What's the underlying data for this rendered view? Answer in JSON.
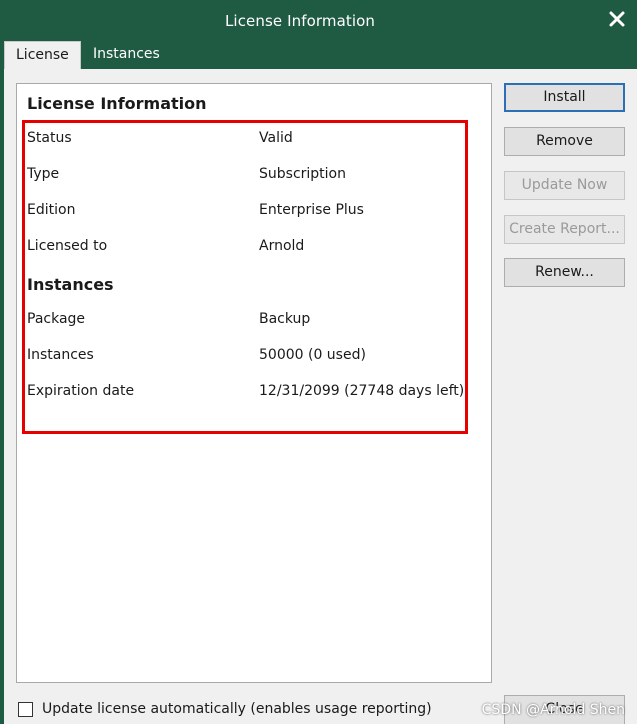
{
  "window": {
    "title": "License Information",
    "close_icon": "close-icon"
  },
  "tabs": [
    {
      "label": "License",
      "active": true
    },
    {
      "label": "Instances",
      "active": false
    }
  ],
  "panel": {
    "license_heading": "License Information",
    "rows": [
      {
        "label": "Status",
        "value": "Valid"
      },
      {
        "label": "Type",
        "value": "Subscription"
      },
      {
        "label": "Edition",
        "value": "Enterprise Plus"
      },
      {
        "label": "Licensed to",
        "value": "Arnold"
      }
    ],
    "instances_heading": "Instances",
    "instance_rows": [
      {
        "label": "Package",
        "value": "Backup"
      },
      {
        "label": "Instances",
        "value": "50000 (0 used)"
      },
      {
        "label": "Expiration date",
        "value": "12/31/2099 (27748 days left)"
      }
    ]
  },
  "buttons": {
    "install": "Install",
    "remove": "Remove",
    "update_now": "Update Now",
    "create_report": "Create Report...",
    "renew": "Renew...",
    "close": "Close"
  },
  "footer": {
    "auto_update_label": "Update license automatically (enables usage reporting)",
    "auto_update_checked": false,
    "watermark": "CSDN @Arnold Shen"
  },
  "colors": {
    "titlebar": "#1f5a43",
    "highlight": "#e60000",
    "primary_border": "#2d6fb5"
  }
}
